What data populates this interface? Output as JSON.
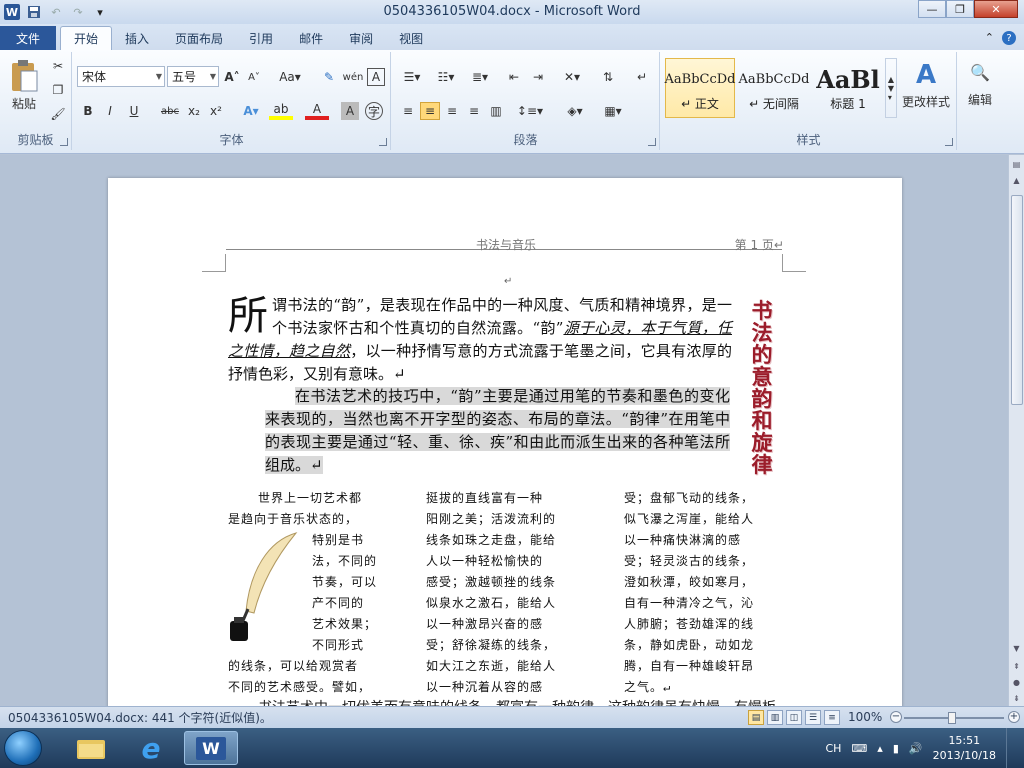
{
  "window": {
    "title": "0504336105W04.docx - Microsoft Word",
    "app_icon": "word-logo-icon",
    "quick_access": [
      "save-icon",
      "undo-icon",
      "redo-icon",
      "customize-icon"
    ],
    "buttons": [
      "minimize",
      "maximize",
      "close"
    ]
  },
  "ribbon_tabs": [
    {
      "label": "文件"
    },
    {
      "label": "开始"
    },
    {
      "label": "插入"
    },
    {
      "label": "页面布局"
    },
    {
      "label": "引用"
    },
    {
      "label": "邮件"
    },
    {
      "label": "审阅"
    },
    {
      "label": "视图"
    }
  ],
  "ribbon": {
    "clipboard": {
      "paste": "粘贴",
      "label": "剪贴板"
    },
    "font": {
      "family": "宋体",
      "size": "五号",
      "label": "字体",
      "grow": "A",
      "shrink": "A",
      "aa": "Aa",
      "bold": "B",
      "italic": "I",
      "underline": "U",
      "strike": "abc",
      "sub": "x₂",
      "sup": "x²"
    },
    "paragraph": {
      "label": "段落"
    },
    "styles": {
      "label": "样式",
      "items": [
        {
          "preview": "AaBbCcDd",
          "name": "↵ 正文"
        },
        {
          "preview": "AaBbCcDd",
          "name": "↵ 无间隔"
        },
        {
          "preview": "AaBl",
          "name": "标题 1"
        }
      ],
      "change": "更改样式"
    },
    "editing": {
      "label": "编辑"
    }
  },
  "document": {
    "header_center": "书法与音乐",
    "header_right": "第 1 页↵",
    "para1": {
      "dropcap": "所",
      "text1": "谓书法的“韵”，是表现在作品中的一种风度、气质和精神境界，是一个书法家怀古和个性真切的自然流露。“韵”",
      "underlined": "源于心灵，本于气質，任之性情，趋之自然",
      "text2": "，以一种抒情写意的方式流露于笔墨之间，它具有浓厚的抒情色彩，又别有意味。↵"
    },
    "para2": "在书法艺术的技巧中，“韵”主要是通过用笔的节奏和墨色的变化来表现的，当然也离不开字型的姿态、布局的章法。“韵律”在用笔中的表现主要是通过“轻、重、徐、疾”和由此而派生出来的各种笔法所组成。↵",
    "vertical_art": "书法的意韵和旋律",
    "col1": [
      "世界上一切艺术都",
      "是趋向于音乐状态的，",
      "特别是书",
      "法，不同的",
      "节奏，可以",
      "产不同的",
      "艺术效果；",
      "不同形式",
      "的线条，可以给观赏者",
      "不同的艺术感受。譬如，"
    ],
    "col2": [
      "挺拔的直线富有一种",
      "阳刚之美；活泼流利的",
      "线条如珠之走盘，能给",
      "人以一种轻松愉快的",
      "感受；激越顿挫的线条",
      "似泉水之激石，能给人",
      "以一种激昂兴奋的感",
      "受；舒徐凝练的线条，",
      "如大江之东逝，能给人",
      "以一种沉着从容的感"
    ],
    "col3": [
      "受；盘郁飞动的线条，",
      "似飞瀑之泻崖，能给人",
      "以一种痛快淋漓的感",
      "受；轻灵淡古的线条，",
      "澄如秋潭，皎如寒月，",
      "自有一种清冷之气，沁",
      "人肺腑；苍劲雄浑的线",
      "条，静如虎卧，动如龙",
      "腾，自有一种雄峻轩昂",
      "之气。↵"
    ],
    "cut_line": "书法艺术中一切优美而有意味的线条，都富有一种韵律，这种韵律虽有快慢、有慢板"
  },
  "statusbar": {
    "info": "0504336105W04.docx: 441 个字符(近似值)。",
    "zoom": "100%"
  },
  "taskbar": {
    "items": [
      "explorer",
      "internet-explorer",
      "word"
    ],
    "lang": "CH",
    "time": "15:51",
    "date": "2013/10/18"
  },
  "colors": {
    "accent": "#2b579a",
    "art": "#9b1c2a"
  }
}
